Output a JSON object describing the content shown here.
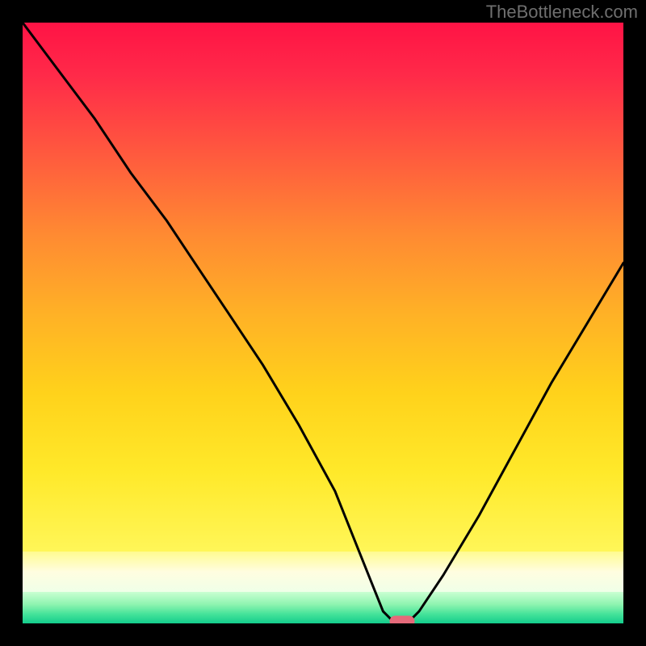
{
  "watermark": "TheBottleneck.com",
  "colors": {
    "bg": "#000000",
    "watermark_text": "#6f6f6f",
    "curve": "#000000",
    "marker_fill": "#e56a7a",
    "marker_stroke": "#e56a7a"
  },
  "chart_data": {
    "type": "line",
    "title": "",
    "xlabel": "",
    "ylabel": "",
    "xlim": [
      0,
      100
    ],
    "ylim": [
      0,
      100
    ],
    "grid": false,
    "series": [
      {
        "name": "bottleneck-curve",
        "x": [
          0,
          6,
          12,
          18,
          24,
          28,
          34,
          40,
          46,
          52,
          56,
          58,
          60,
          62,
          64,
          66,
          70,
          76,
          82,
          88,
          94,
          100
        ],
        "y": [
          100,
          92,
          84,
          75,
          67,
          61,
          52,
          43,
          33,
          22,
          12,
          7,
          2,
          0,
          0,
          2,
          8,
          18,
          29,
          40,
          50,
          60
        ]
      }
    ],
    "marker": {
      "x": 63,
      "y": 0,
      "shape": "pill"
    },
    "background_bands": [
      {
        "y_from": 100,
        "y_to": 12,
        "gradient": [
          "#ff1744",
          "#ff3b4a",
          "#ff6a3b",
          "#ff9a2e",
          "#ffc21f",
          "#ffe017",
          "#fff22a"
        ]
      },
      {
        "y_from": 12,
        "y_to": 6,
        "gradient": [
          "#fff8a0",
          "#fffcd0",
          "#f6ffe0"
        ]
      },
      {
        "y_from": 6,
        "y_to": 2,
        "gradient": [
          "#d4ffd0",
          "#9df7b5",
          "#5fe9a0"
        ]
      },
      {
        "y_from": 2,
        "y_to": 0,
        "gradient": [
          "#28df93",
          "#12c98a"
        ]
      }
    ]
  }
}
